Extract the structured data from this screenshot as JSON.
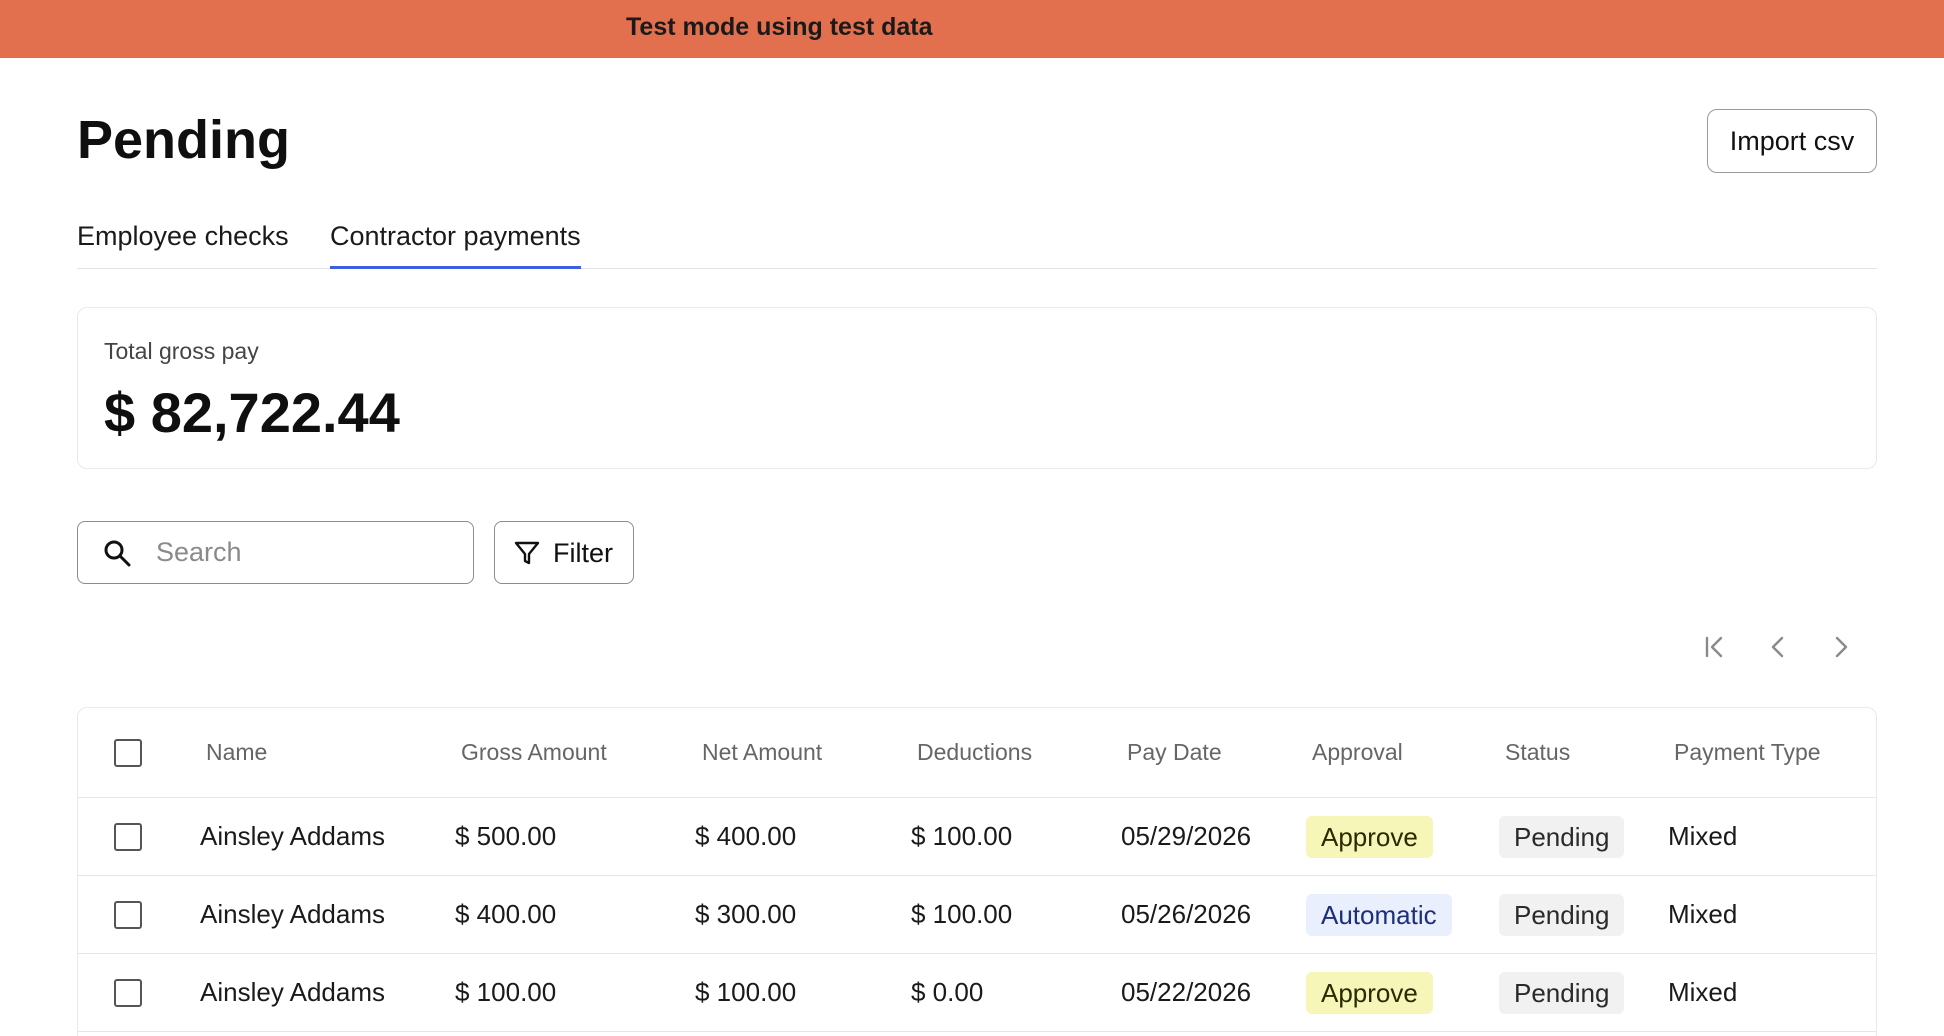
{
  "banner": {
    "text": "Test mode using test data",
    "color": "#e2704f"
  },
  "header": {
    "title": "Pending",
    "import_label": "Import csv"
  },
  "tabs": [
    {
      "label": "Employee checks",
      "active": false
    },
    {
      "label": "Contractor payments",
      "active": true
    }
  ],
  "accent_color": "#3b5fe0",
  "summary": {
    "label": "Total gross pay",
    "value": "$ 82,722.44"
  },
  "search": {
    "placeholder": "Search",
    "value": ""
  },
  "filter": {
    "label": "Filter"
  },
  "pagination": {
    "icons": [
      "first-page-icon",
      "previous-page-icon",
      "next-page-icon"
    ]
  },
  "table": {
    "columns": [
      "Name",
      "Gross Amount",
      "Net Amount",
      "Deductions",
      "Pay Date",
      "Approval",
      "Status",
      "Payment Type"
    ],
    "rows": [
      {
        "name": "Ainsley Addams",
        "gross": "$ 500.00",
        "net": "$ 400.00",
        "deductions": "$ 100.00",
        "pay_date": "05/29/2026",
        "approval": "Approve",
        "status": "Pending",
        "payment_type": "Mixed"
      },
      {
        "name": "Ainsley Addams",
        "gross": "$ 400.00",
        "net": "$ 300.00",
        "deductions": "$ 100.00",
        "pay_date": "05/26/2026",
        "approval": "Automatic",
        "status": "Pending",
        "payment_type": "Mixed"
      },
      {
        "name": "Ainsley Addams",
        "gross": "$ 100.00",
        "net": "$ 100.00",
        "deductions": "$ 0.00",
        "pay_date": "05/22/2026",
        "approval": "Approve",
        "status": "Pending",
        "payment_type": "Mixed"
      }
    ]
  }
}
